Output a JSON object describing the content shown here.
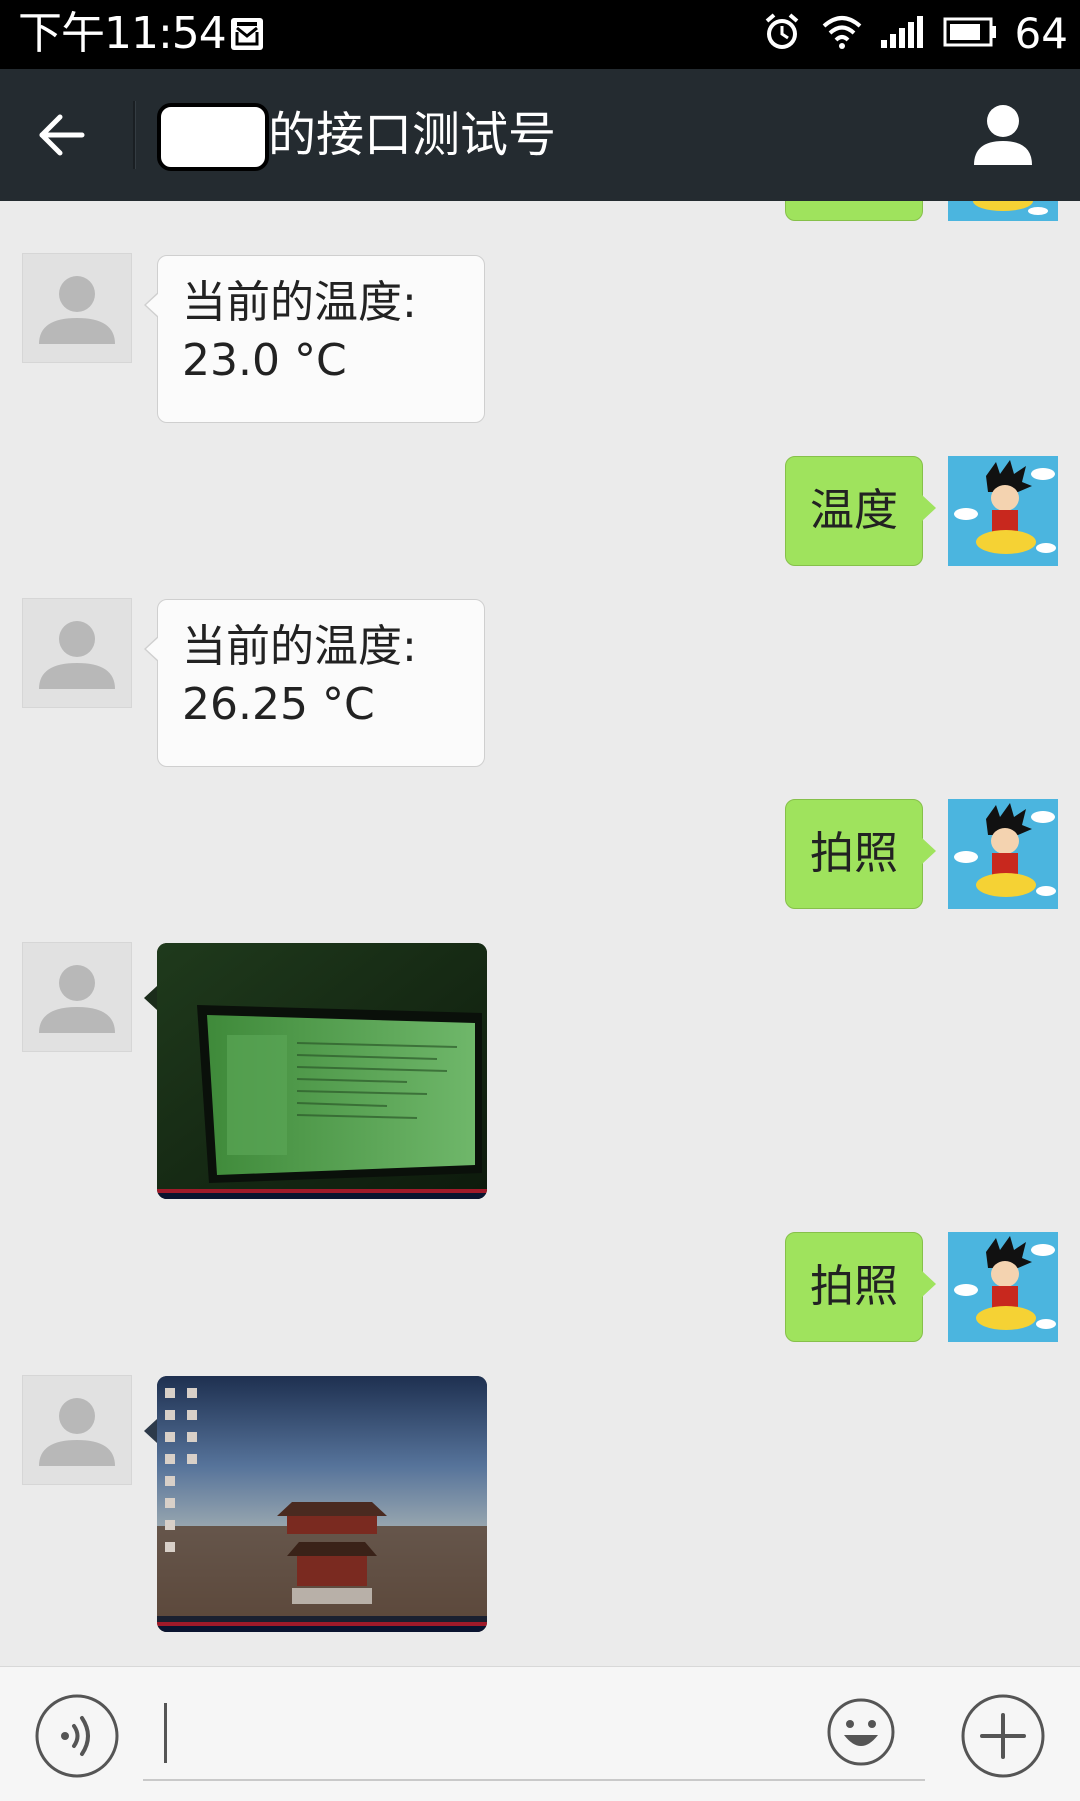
{
  "status_bar": {
    "time": "下午11:54",
    "battery": "64"
  },
  "header": {
    "title": "的接口测试号"
  },
  "messages": [
    {
      "side": "in",
      "type": "text",
      "line1": "当前的温度:",
      "line2": "23.0 °C"
    },
    {
      "side": "out",
      "type": "text",
      "text": "温度"
    },
    {
      "side": "in",
      "type": "text",
      "line1": "当前的温度:",
      "line2": "26.25 °C"
    },
    {
      "side": "out",
      "type": "text",
      "text": "拍照"
    },
    {
      "side": "in",
      "type": "image",
      "scene": "green-tinted laptop screen"
    },
    {
      "side": "out",
      "type": "text",
      "text": "拍照"
    },
    {
      "side": "in",
      "type": "image",
      "scene": "desktop wallpaper of palace"
    }
  ],
  "colors": {
    "header_bg": "#242b30",
    "chat_bg": "#ebebeb",
    "outgoing_bubble": "#9fe35d",
    "incoming_bubble": "#fbfbfb"
  },
  "input": {
    "placeholder": ""
  }
}
